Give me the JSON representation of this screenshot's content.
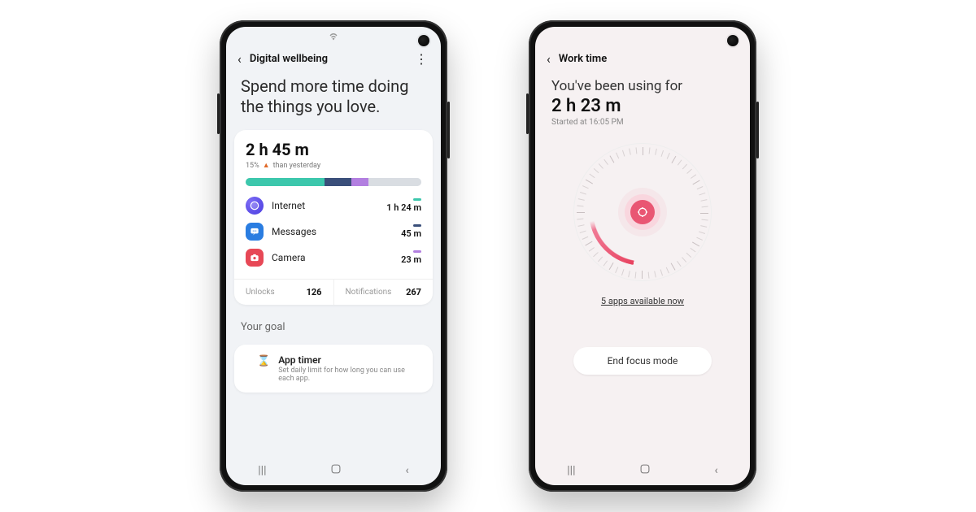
{
  "left": {
    "header_title": "Digital wellbeing",
    "headline": "Spend more time doing the things you love.",
    "total_time": "2 h 45 m",
    "delta_pct": "15%",
    "delta_text": "than yesterday",
    "segments": [
      {
        "color": "#3cc7ac",
        "pct": 45
      },
      {
        "color": "#3a4f7a",
        "pct": 15
      },
      {
        "color": "#b27fe0",
        "pct": 10
      },
      {
        "color": "#d9dde2",
        "pct": 30
      }
    ],
    "apps": [
      {
        "key": "int",
        "name": "Internet",
        "time": "1 h 24 m",
        "dot": "#3cc7ac"
      },
      {
        "key": "msg",
        "name": "Messages",
        "time": "45 m",
        "dot": "#3a4f7a"
      },
      {
        "key": "cam",
        "name": "Camera",
        "time": "23 m",
        "dot": "#b27fe0"
      }
    ],
    "unlocks_label": "Unlocks",
    "unlocks_value": "126",
    "notifs_label": "Notifications",
    "notifs_value": "267",
    "goal_header": "Your goal",
    "goal_item_title": "App timer",
    "goal_item_sub": "Set daily limit for how long you can use each app."
  },
  "right": {
    "header_title": "Work time",
    "line1": "You've been using for",
    "time": "2 h 23 m",
    "started": "Started at 16:05 PM",
    "apps_link": "5 apps available now",
    "end_button": "End focus mode"
  }
}
